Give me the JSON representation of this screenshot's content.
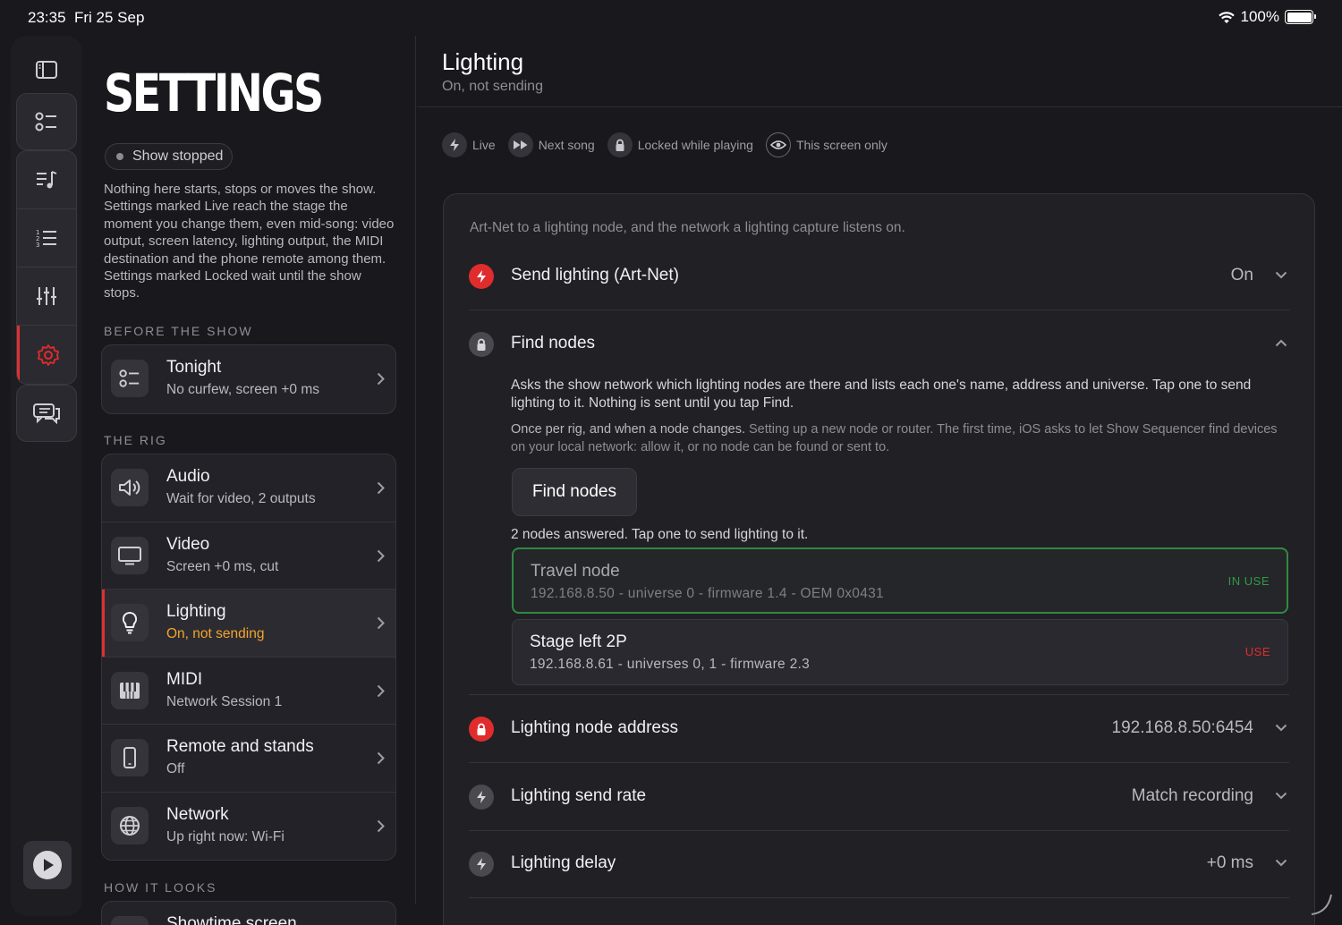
{
  "status_bar": {
    "time": "23:35",
    "date": "Fri 25 Sep",
    "battery": "100%"
  },
  "sidebar": {
    "title": "SETTINGS",
    "show_state": "Show stopped",
    "intro": "Nothing here starts, stops or moves the show. Settings marked Live reach the stage the moment you change them, even mid-song: video output, screen latency, lighting output, the MIDI destination and the phone remote among them. Settings marked Locked wait until the show stops.",
    "sections": [
      {
        "heading": "BEFORE THE SHOW",
        "items": [
          {
            "title": "Tonight",
            "sub": "No curfew, screen +0 ms",
            "icon": "checklist-icon"
          }
        ]
      },
      {
        "heading": "THE RIG",
        "items": [
          {
            "title": "Audio",
            "sub": "Wait for video, 2 outputs",
            "icon": "speaker-icon"
          },
          {
            "title": "Video",
            "sub": "Screen +0 ms, cut",
            "icon": "monitor-icon"
          },
          {
            "title": "Lighting",
            "sub": "On, not sending",
            "icon": "bulb-icon"
          },
          {
            "title": "MIDI",
            "sub": "Network Session 1",
            "icon": "piano-icon"
          },
          {
            "title": "Remote and stands",
            "sub": "Off",
            "icon": "phone-icon"
          },
          {
            "title": "Network",
            "sub": "Up right now: Wi-Fi",
            "icon": "globe-icon"
          }
        ]
      },
      {
        "heading": "HOW IT LOOKS",
        "items": [
          {
            "title": "Showtime screen",
            "sub": ""
          }
        ]
      }
    ]
  },
  "main": {
    "title": "Lighting",
    "subtitle": "On, not sending",
    "legend": [
      "Live",
      "Next song",
      "Locked while playing",
      "This screen only"
    ],
    "description": "Art-Net to a lighting node, and the network a lighting capture listens on.",
    "send": {
      "label": "Send lighting (Art-Net)",
      "value": "On"
    },
    "find": {
      "label": "Find nodes",
      "desc": "Asks the show network which lighting nodes are there and lists each one's name, address and universe. Tap one to send lighting to it. Nothing is sent until you tap Find.",
      "note_lead": "Once per rig, and when a node changes.",
      "note_rest": "Setting up a new node or router. The first time, iOS asks to let Show Sequencer find devices on your local network: allow it, or no node can be found or sent to.",
      "button": "Find nodes",
      "answered": "2 nodes answered. Tap one to send lighting to it.",
      "nodes": [
        {
          "name": "Travel node",
          "meta": "192.168.8.50 - universe 0 - firmware 1.4 - OEM 0x0431",
          "tag": "IN USE"
        },
        {
          "name": "Stage left 2P",
          "meta": "192.168.8.61 - universes 0, 1 - firmware 2.3",
          "tag": "USE"
        }
      ]
    },
    "address": {
      "label": "Lighting node address",
      "value": "192.168.8.50:6454"
    },
    "rate": {
      "label": "Lighting send rate",
      "value": "Match recording"
    },
    "delay": {
      "label": "Lighting delay",
      "value": "+0 ms"
    }
  },
  "colors": {
    "accent": "#e02c2c",
    "orange": "#f0a62a",
    "green": "#2f9a48",
    "background": "#19181c"
  }
}
